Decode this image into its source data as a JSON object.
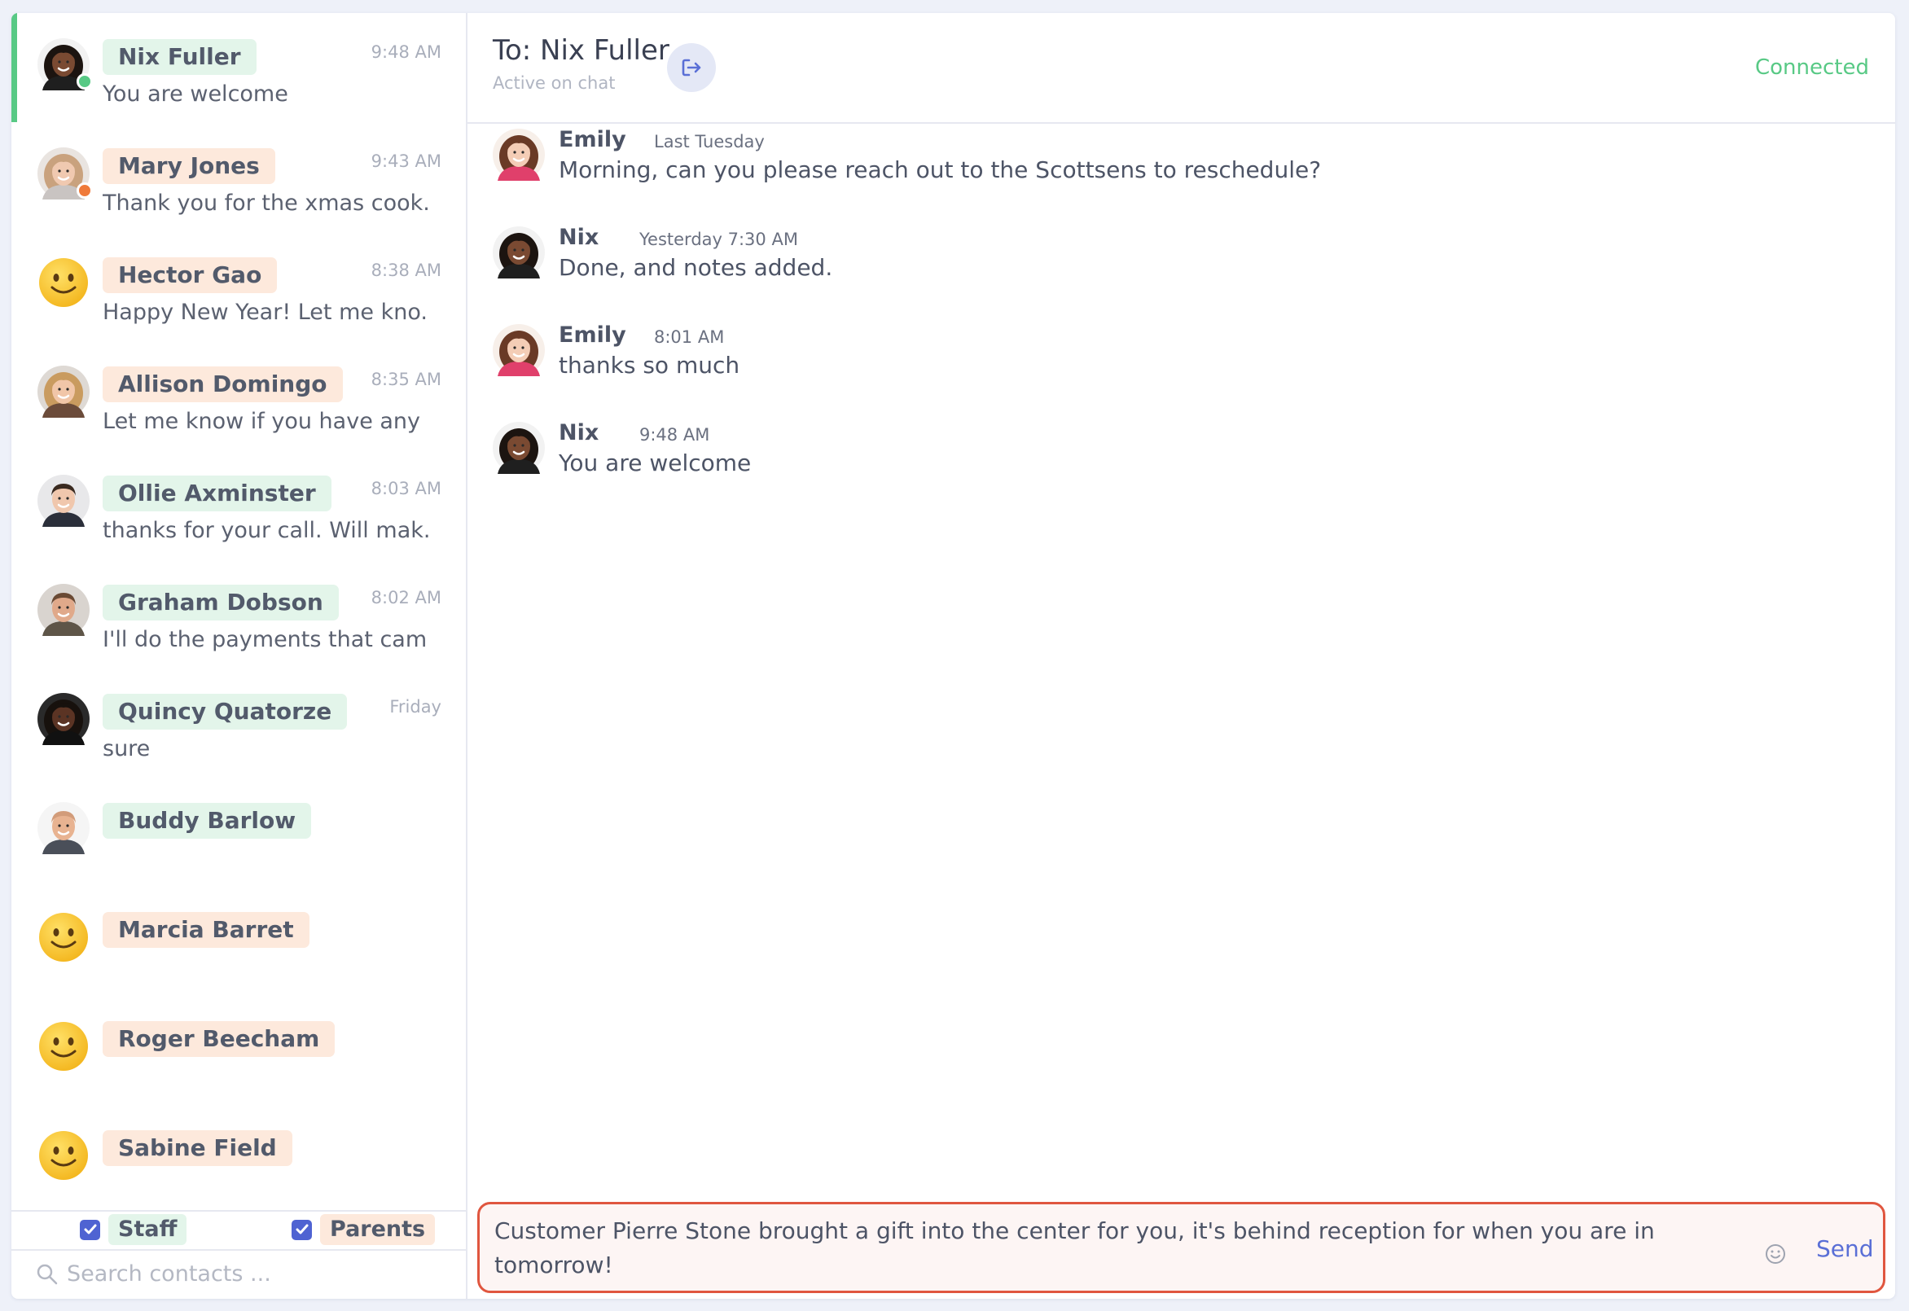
{
  "contacts": [
    {
      "name": "Nix Fuller",
      "time": "9:48 AM",
      "preview": "You are welcome",
      "pill": "green",
      "avatar": "photo-dark",
      "status": "online",
      "active": true
    },
    {
      "name": "Mary Jones",
      "time": "9:43 AM",
      "preview": "Thank you for the xmas cook...",
      "pill": "orange",
      "avatar": "photo-light",
      "status": "away",
      "active": false
    },
    {
      "name": "Hector Gao",
      "time": "8:38 AM",
      "preview": "Happy New Year! Let me kno...",
      "pill": "orange",
      "avatar": "smiley",
      "status": "",
      "active": false
    },
    {
      "name": "Allison Domingo",
      "time": "8:35 AM",
      "preview": "Let me know if you have any ...",
      "pill": "orange",
      "avatar": "photo-blonde",
      "status": "",
      "active": false
    },
    {
      "name": "Ollie Axminster",
      "time": "8:03 AM",
      "preview": "thanks for your call. Will mak...",
      "pill": "green",
      "avatar": "photo-suit",
      "status": "",
      "active": false
    },
    {
      "name": "Graham Dobson",
      "time": "8:02 AM",
      "preview": "I'll do the payments that cam...",
      "pill": "green",
      "avatar": "photo-man",
      "status": "",
      "active": false
    },
    {
      "name": "Quincy Quatorze",
      "time": "Friday",
      "preview": "sure",
      "pill": "green",
      "avatar": "photo-dark2",
      "status": "",
      "active": false
    },
    {
      "name": "Buddy Barlow",
      "time": "",
      "preview": "",
      "pill": "green",
      "avatar": "photo-bald",
      "status": "",
      "active": false
    },
    {
      "name": "Marcia Barret",
      "time": "",
      "preview": "",
      "pill": "orange",
      "avatar": "smiley",
      "status": "",
      "active": false
    },
    {
      "name": "Roger Beecham",
      "time": "",
      "preview": "",
      "pill": "orange",
      "avatar": "smiley",
      "status": "",
      "active": false
    },
    {
      "name": "Sabine Field",
      "time": "",
      "preview": "",
      "pill": "orange",
      "avatar": "smiley",
      "status": "",
      "active": false
    }
  ],
  "filters": {
    "staff": "Staff",
    "parents": "Parents"
  },
  "search": {
    "placeholder": "Search contacts ..."
  },
  "chat": {
    "title": "To: Nix Fuller",
    "subtitle": "Active on chat",
    "status": "Connected",
    "messages": [
      {
        "sender": "Emily",
        "time": "Last Tuesday",
        "text": "Morning, can you please reach out to the Scottsens to reschedule?",
        "avatar": "emily"
      },
      {
        "sender": "Nix",
        "time": "Yesterday 7:30 AM",
        "text": "Done, and notes added.",
        "avatar": "nix"
      },
      {
        "sender": "Emily",
        "time": "8:01 AM",
        "text": "thanks so much",
        "avatar": "emily"
      },
      {
        "sender": "Nix",
        "time": "9:48 AM",
        "text": "You are welcome",
        "avatar": "nix"
      }
    ]
  },
  "composer": {
    "value": "Customer Pierre Stone brought a gift into the center for you, it's behind reception for when you are in tomorrow!",
    "send_label": "Send"
  },
  "colors": {
    "accent": "#4f63d2",
    "online": "#58c985",
    "away": "#ef7a3a",
    "composer_border": "#e0563f",
    "pill_green": "#e3f5ea",
    "pill_orange": "#fde9dc"
  }
}
